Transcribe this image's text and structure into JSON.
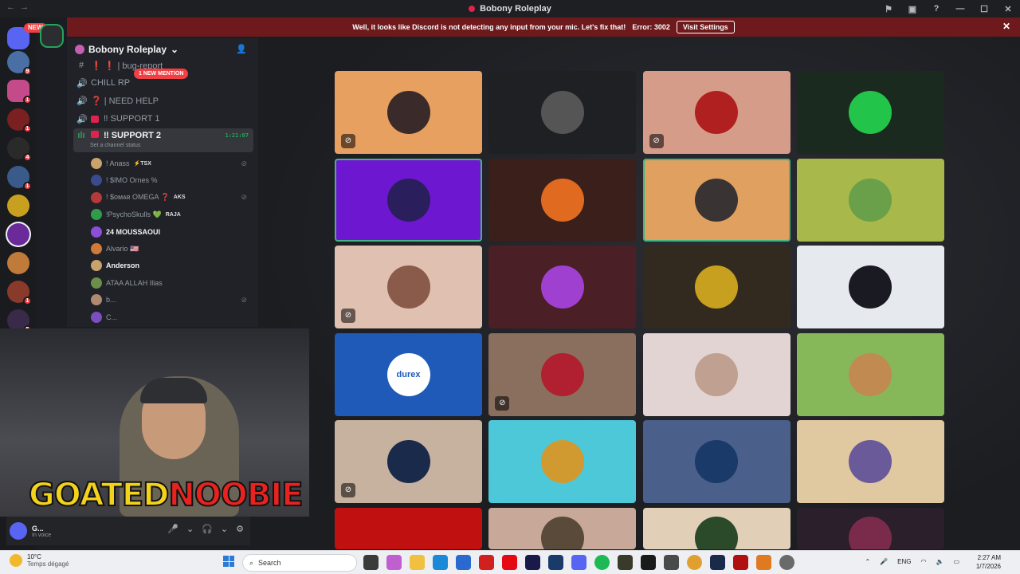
{
  "window": {
    "title": "Bobony Roleplay",
    "nav_back": "←",
    "nav_fwd": "→",
    "controls": [
      "⚑",
      "▣",
      "?",
      "—",
      "☐",
      "✕"
    ]
  },
  "rail": {
    "new_label": "NEW",
    "badges": [
      "9",
      "1",
      "1",
      "4",
      "1",
      "1",
      "5"
    ]
  },
  "guild": {
    "name": "Bobony Roleplay",
    "chevron": "⌄",
    "invite_icon": "person-add-icon"
  },
  "banner": {
    "message": "Well, it looks like Discord is not detecting any input from your mic. Let's fix that!",
    "error": "Error: 3002",
    "button": "Visit Settings",
    "close": "✕"
  },
  "channels": {
    "mention_pill": "1 NEW MENTION",
    "items": [
      {
        "name": "❗ ❗ | bug-report",
        "icon": "#"
      },
      {
        "name": "CHILL RP",
        "icon": "🔊"
      },
      {
        "name": "❓ | NEED HELP",
        "icon": "🔊"
      },
      {
        "name": "‼ SUPPORT 1",
        "icon": "🔊"
      },
      {
        "name": "‼ SUPPORT 2",
        "icon": "🔊",
        "timer": "1:21:07",
        "status": "Set a channel status"
      }
    ]
  },
  "members": [
    {
      "name": "! Anass",
      "tag": "⚡TSX",
      "color": "#c9a36b",
      "muted": true
    },
    {
      "name": "! $IMO Ornes %",
      "tag": "",
      "color": "#3b4a8c",
      "muted": false
    },
    {
      "name": "! $ᴏᴍᴀʀ OMEGA ❓",
      "tag": "AKS",
      "color": "#b33a3a",
      "muted": true
    },
    {
      "name": "!PsychoSkulls 💚",
      "tag": "RAJA",
      "color": "#2f9c4a",
      "muted": false
    },
    {
      "name": "24 MOUSSAOUI",
      "tag": "",
      "color": "#8a4fd6",
      "muted": false,
      "bright": true
    },
    {
      "name": "Alvario 🇺🇸",
      "tag": "",
      "color": "#d07a3a",
      "muted": false
    },
    {
      "name": "Anderson",
      "tag": "",
      "color": "#c9a36b",
      "muted": false,
      "bright": true
    },
    {
      "name": "ATAA ALLAH Ilias",
      "tag": "",
      "color": "#6b8f4a",
      "muted": false
    },
    {
      "name": "b...",
      "tag": "",
      "color": "#b08a70",
      "muted": true
    },
    {
      "name": "C...",
      "tag": "",
      "color": "#7a4fbf",
      "muted": false
    }
  ],
  "tiles": [
    {
      "bg": "#e8a060",
      "av": "#3a2a2a",
      "muted": true,
      "speaking": false
    },
    {
      "bg": "#1f2023",
      "av": "#555",
      "muted": false,
      "speaking": false
    },
    {
      "bg": "#d69c8a",
      "av": "#b02020",
      "muted": true,
      "speaking": false
    },
    {
      "bg": "#1a2a1f",
      "av": "#22c44a",
      "muted": false,
      "speaking": false
    },
    {
      "bg": "#6d17d0",
      "av": "#2a1f5c",
      "muted": false,
      "speaking": true
    },
    {
      "bg": "#3a1f1a",
      "av": "#e06a20",
      "muted": false,
      "speaking": false
    },
    {
      "bg": "#e0a060",
      "av": "#3a3333",
      "muted": false,
      "speaking": true
    },
    {
      "bg": "#a8b84a",
      "av": "#6aa04a",
      "muted": false,
      "speaking": false
    },
    {
      "bg": "#e0c0b0",
      "av": "#8a5a4a",
      "muted": true,
      "speaking": false
    },
    {
      "bg": "#4a1f25",
      "av": "#a040d0",
      "muted": false,
      "speaking": false
    },
    {
      "bg": "#332a1f",
      "av": "#c8a020",
      "muted": false,
      "speaking": false
    },
    {
      "bg": "#e6eaef",
      "av": "#1a1a22",
      "muted": false,
      "speaking": false
    },
    {
      "bg": "#1f5ab8",
      "av": "#2a7ad8",
      "muted": false,
      "speaking": false,
      "label": "durex"
    },
    {
      "bg": "#8a6f5f",
      "av": "#b02030",
      "muted": true,
      "speaking": false
    },
    {
      "bg": "#e2d4d2",
      "av": "#c0a090",
      "muted": false,
      "speaking": false
    },
    {
      "bg": "#86b85a",
      "av": "#c08a50",
      "muted": false,
      "speaking": false
    },
    {
      "bg": "#c7b19f",
      "av": "#1a2a4a",
      "muted": true,
      "speaking": false
    },
    {
      "bg": "#4cc8d8",
      "av": "#d09a30",
      "muted": false,
      "speaking": false
    },
    {
      "bg": "#4a5f8a",
      "av": "#1a3a6a",
      "muted": false,
      "speaking": false
    },
    {
      "bg": "#e0c8a0",
      "av": "#6a5a9a",
      "muted": false,
      "speaking": false
    },
    {
      "bg": "#c01010",
      "av": "#c01010",
      "muted": false,
      "speaking": false
    },
    {
      "bg": "#c8a898",
      "av": "#5a4a3a",
      "muted": false,
      "speaking": false
    },
    {
      "bg": "#e2cfb8",
      "av": "#2a4a2a",
      "muted": false,
      "speaking": false
    },
    {
      "bg": "#2a1f2a",
      "av": "#7a2a4a",
      "muted": false,
      "speaking": false
    }
  ],
  "stream_logo": {
    "part1": "GOATED",
    "part2": "NOOBIE"
  },
  "user": {
    "name": "G...",
    "status": "In voice",
    "controls": [
      "🎤",
      "⌄",
      "🎧",
      "⌄",
      "⚙"
    ]
  },
  "taskbar": {
    "temp": "10°C",
    "weather": "Temps dégagé",
    "search": "Search",
    "tray_lang": "ENG",
    "time": "2:27 AM",
    "date": "1/7/2026"
  }
}
